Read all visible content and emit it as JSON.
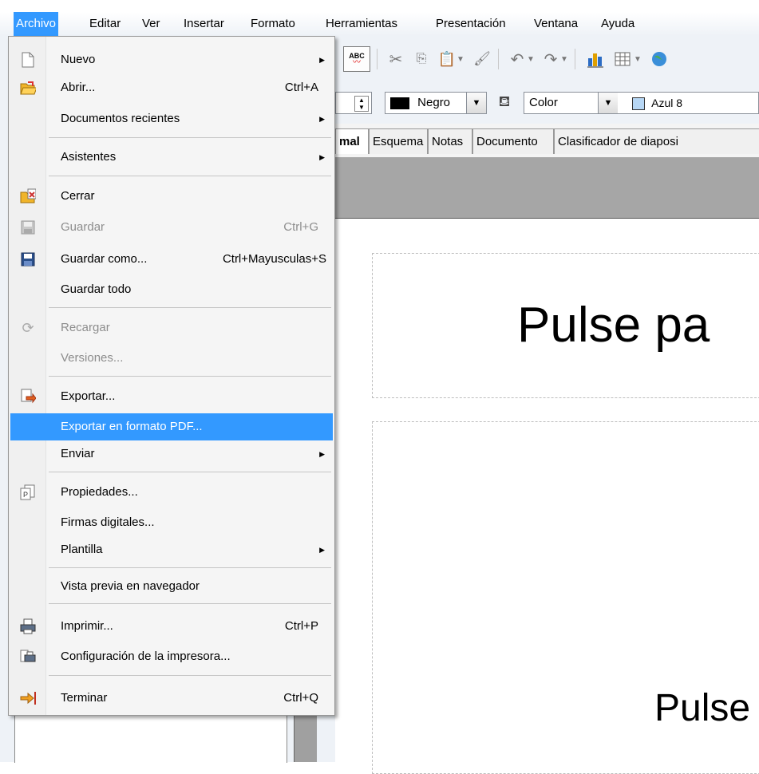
{
  "menubar": {
    "items": [
      {
        "label": "Archivo"
      },
      {
        "label": "Editar"
      },
      {
        "label": "Ver"
      },
      {
        "label": "Insertar"
      },
      {
        "label": "Formato"
      },
      {
        "label": "Herramientas"
      },
      {
        "label": "Presentación"
      },
      {
        "label": "Ventana"
      },
      {
        "label": "Ayuda"
      }
    ]
  },
  "toolbar": {
    "spellcheck_label": "ABC",
    "line_color": "Negro",
    "area_style": "Color",
    "area_color": "Azul 8"
  },
  "tabs": [
    "mal",
    "Esquema",
    "Notas",
    "Documento",
    "Clasificador de diaposi"
  ],
  "slide": {
    "title_placeholder": "Pulse pa",
    "body_placeholder": "Pulse"
  },
  "menu": {
    "items": [
      {
        "label": "Nuevo",
        "shortcut": "",
        "submenu": true
      },
      {
        "label": "Abrir...",
        "shortcut": "Ctrl+A"
      },
      {
        "label": "Documentos recientes",
        "shortcut": "",
        "submenu": true
      },
      {
        "label": "Asistentes",
        "shortcut": "",
        "submenu": true
      },
      {
        "label": "Cerrar",
        "shortcut": ""
      },
      {
        "label": "Guardar",
        "shortcut": "Ctrl+G",
        "disabled": true
      },
      {
        "label": "Guardar como...",
        "shortcut": "Ctrl+Mayusculas+S"
      },
      {
        "label": "Guardar todo",
        "shortcut": ""
      },
      {
        "label": "Recargar",
        "shortcut": "",
        "disabled": true
      },
      {
        "label": "Versiones...",
        "shortcut": "",
        "disabled": true
      },
      {
        "label": "Exportar...",
        "shortcut": ""
      },
      {
        "label": "Exportar en formato PDF...",
        "shortcut": "",
        "highlighted": true
      },
      {
        "label": "Enviar",
        "shortcut": "",
        "submenu": true
      },
      {
        "label": "Propiedades...",
        "shortcut": ""
      },
      {
        "label": "Firmas digitales...",
        "shortcut": ""
      },
      {
        "label": "Plantilla",
        "shortcut": "",
        "submenu": true
      },
      {
        "label": "Vista previa en navegador",
        "shortcut": ""
      },
      {
        "label": "Imprimir...",
        "shortcut": "Ctrl+P"
      },
      {
        "label": "Configuración de la impresora...",
        "shortcut": ""
      },
      {
        "label": "Terminar",
        "shortcut": "Ctrl+Q"
      }
    ]
  },
  "colors": {
    "highlight": "#3399ff",
    "menu_bg": "#f5f5f5",
    "disabled_text": "#8d8d8d"
  }
}
